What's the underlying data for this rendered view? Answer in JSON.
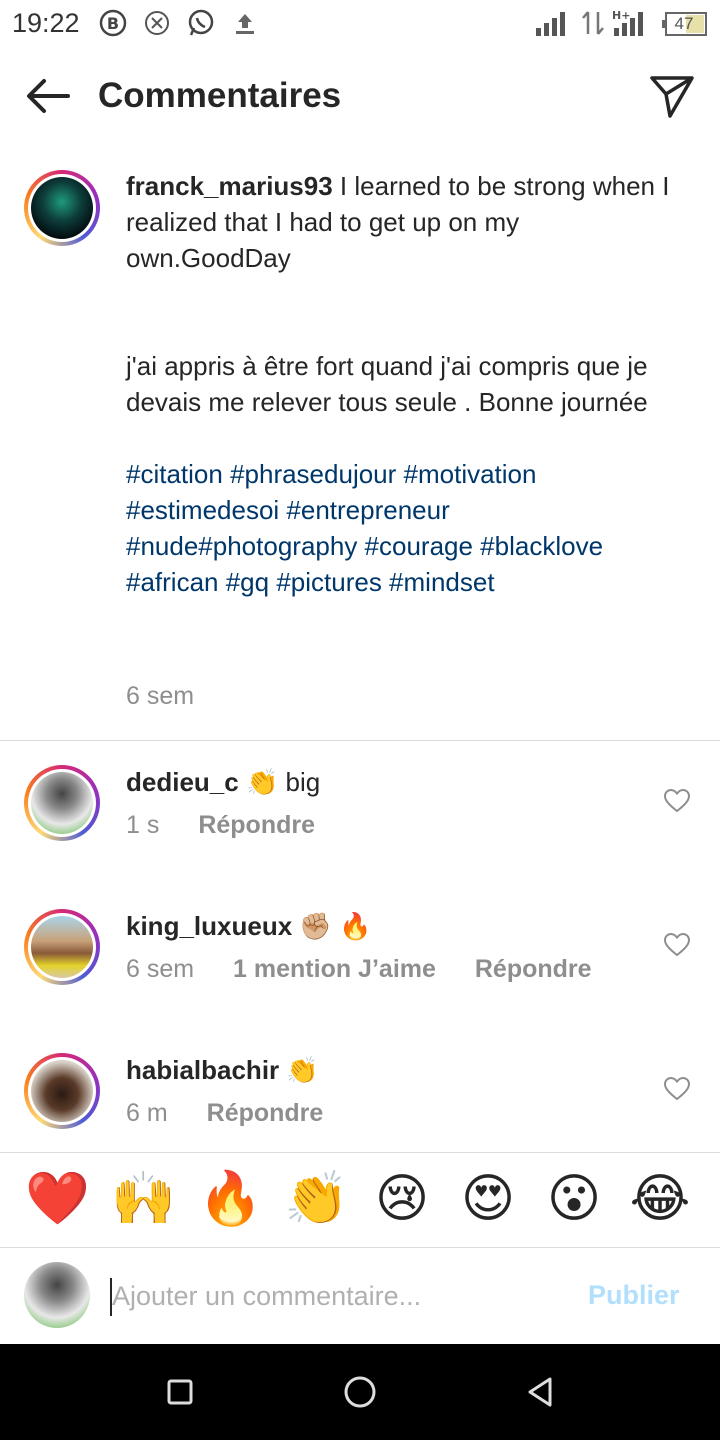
{
  "status_bar": {
    "time": "19:22",
    "battery": "47",
    "icons": [
      "b-circle-icon",
      "close-circle-icon",
      "whatsapp-icon",
      "upload-icon",
      "signal-icon",
      "data-arrows-icon",
      "h-plus-signal-icon",
      "battery-icon"
    ]
  },
  "header": {
    "title": "Commentaires",
    "back_icon": "arrow-left-icon",
    "send_icon": "paper-plane-icon"
  },
  "caption": {
    "username": "franck_marius93",
    "text_en": "I learned to be strong when I realized that I had to get up on my own.GoodDay",
    "text_fr": "j'ai appris à être fort quand j'ai compris que je devais me relever tous seule . Bonne journée",
    "hashtags": "#citation #phrasedujour #motivation #estimedesoi #entrepreneur #nude#photography #courage #blacklove #african #gq #pictures #mindset",
    "time": "6 sem"
  },
  "comments": [
    {
      "username": "dedieu_c",
      "text": "👏 big",
      "time": "1 s",
      "likes": "",
      "reply": "Répondre"
    },
    {
      "username": "king_luxueux",
      "text": "✊🏼 🔥",
      "time": "6 sem",
      "likes": "1 mention J’aime",
      "reply": "Répondre"
    },
    {
      "username": "habialbachir",
      "text": "👏",
      "time": "6 m",
      "likes": "",
      "reply": "Répondre"
    }
  ],
  "reactions": [
    "❤️",
    "🙌",
    "🔥",
    "👏",
    "😢",
    "😍",
    "😮",
    "😂"
  ],
  "input": {
    "placeholder": "Ajouter un commentaire...",
    "value": "",
    "publish_label": "Publier"
  },
  "colors": {
    "hashtag": "#00376b",
    "meta_gray": "#8e8e8e",
    "publish_disabled": "#b2dffc",
    "divider": "#dbdbdb"
  }
}
